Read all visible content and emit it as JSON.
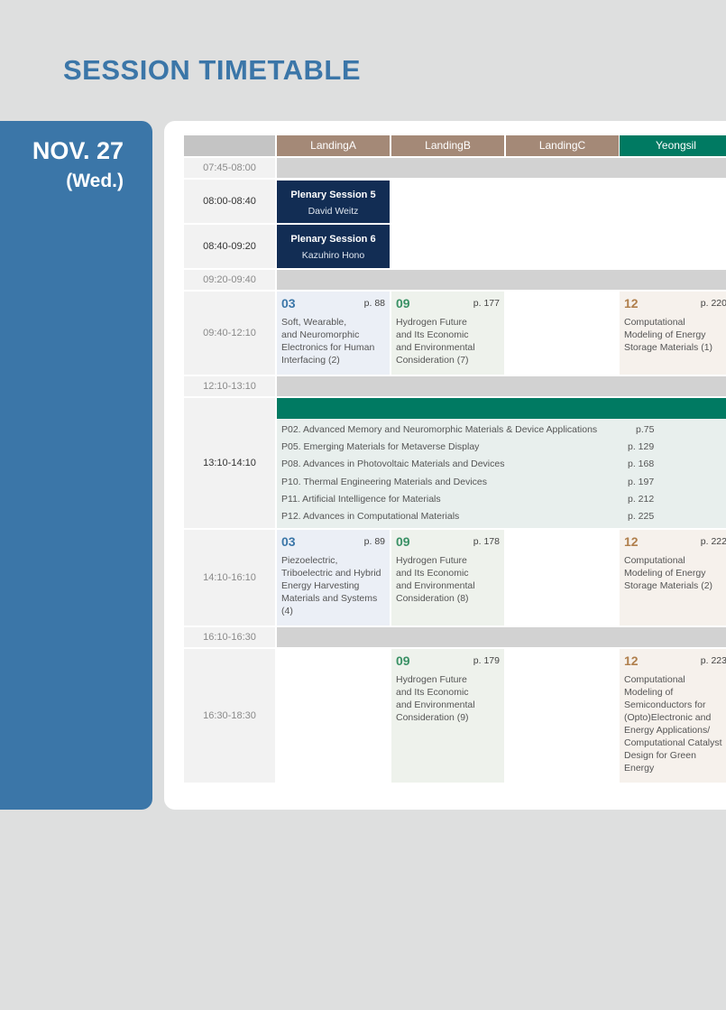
{
  "page_title": "SESSION TIMETABLE",
  "date": {
    "main": "NOV. 27",
    "weekday": "(Wed.)"
  },
  "columns": [
    {
      "label": "LandingA",
      "color": "#a48977"
    },
    {
      "label": "LandingB",
      "color": "#a48977"
    },
    {
      "label": "LandingC",
      "color": "#a48977"
    },
    {
      "label": "Yeongsil",
      "color": "#007a62"
    }
  ],
  "times": [
    "07:45-08:00",
    "08:00-08:40",
    "08:40-09:20",
    "09:20-09:40",
    "09:40-12:10",
    "12:10-13:10",
    "13:10-14:10",
    "14:10-16:10",
    "16:10-16:30",
    "16:30-18:30"
  ],
  "plenaries": [
    {
      "title": "Plenary Session 5",
      "speaker": "David Weitz"
    },
    {
      "title": "Plenary Session 6",
      "speaker": "Kazuhiro Hono"
    }
  ],
  "sessions": {
    "a1": {
      "num": "03",
      "page": "p. 88",
      "lines": [
        "Soft, Wearable,",
        "and Neuromorphic",
        "Electronics for Human",
        "Interfacing (2)"
      ]
    },
    "b1": {
      "num": "09",
      "page": "p. 177",
      "lines": [
        "Hydrogen Future",
        "and Its Economic",
        "and Environmental",
        "Consideration (7)"
      ]
    },
    "d1": {
      "num": "12",
      "page": "p. 220",
      "lines": [
        "Computational",
        "Modeling of Energy",
        "Storage Materials (1)"
      ]
    },
    "a2": {
      "num": "03",
      "page": "p. 89",
      "lines": [
        "Piezoelectric,",
        "Triboelectric and Hybrid",
        "Energy Harvesting",
        "Materials and Systems",
        "(4)"
      ]
    },
    "b2": {
      "num": "09",
      "page": "p. 178",
      "lines": [
        "Hydrogen Future",
        "and Its Economic",
        "and Environmental",
        "Consideration (8)"
      ]
    },
    "d2": {
      "num": "12",
      "page": "p. 222",
      "lines": [
        "Computational",
        "Modeling of Energy",
        "Storage Materials (2)"
      ]
    },
    "b3": {
      "num": "09",
      "page": "p. 179",
      "lines": [
        "Hydrogen Future",
        "and Its Economic",
        "and Environmental",
        "Consideration (9)"
      ]
    },
    "d3": {
      "num": "12",
      "page": "p. 223",
      "lines": [
        "Computational",
        "Modeling of",
        "Semiconductors for",
        "(Opto)Electronic and",
        "Energy Applications/",
        "Computational Catalyst",
        "Design for Green",
        "Energy"
      ]
    }
  },
  "posters": [
    {
      "name": "P02. Advanced Memory and Neuromorphic Materials & Device Applications",
      "page": "p.75"
    },
    {
      "name": "P05. Emerging Materials for Metaverse Display",
      "page": "p. 129"
    },
    {
      "name": "P08. Advances in Photovoltaic Materials and Devices",
      "page": "p. 168"
    },
    {
      "name": "P10. Thermal Engineering Materials and Devices",
      "page": "p. 197"
    },
    {
      "name": "P11. Artificial Intelligence for Materials",
      "page": "p. 212"
    },
    {
      "name": "P12. Advances in Computational Materials",
      "page": "p. 225"
    }
  ]
}
